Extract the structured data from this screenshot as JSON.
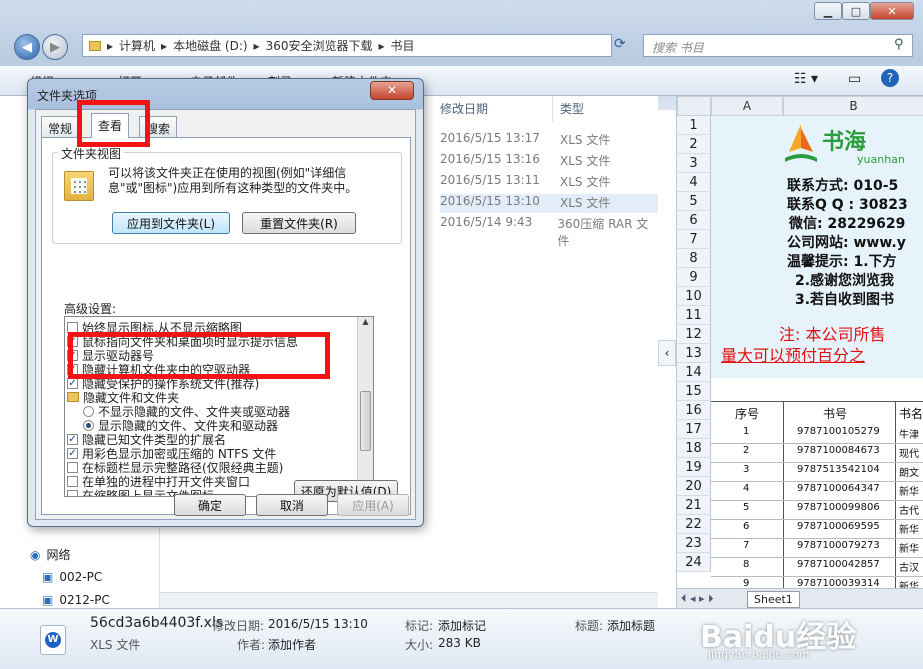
{
  "explorer": {
    "path": [
      "计算机",
      "本地磁盘 (D:)",
      "360安全浏览器下载",
      "书目"
    ],
    "search_placeholder": "搜索 书目",
    "toolbar": [
      "组织 ▼",
      "打开 ▼",
      "电子邮件",
      "刻录",
      "新建文件夹"
    ],
    "columns": {
      "date": "修改日期",
      "type": "类型"
    },
    "files": [
      {
        "date": "2016/5/15 13:17",
        "type": "XLS 文件"
      },
      {
        "date": "2016/5/15 13:16",
        "type": "XLS 文件"
      },
      {
        "date": "2016/5/15 13:11",
        "type": "XLS 文件"
      },
      {
        "date": "2016/5/15 13:10",
        "type": "XLS 文件"
      },
      {
        "date": "2016/5/14 9:43",
        "type": "360压缩 RAR 文件"
      }
    ],
    "nav": [
      "网络",
      "002-PC",
      "0212-PC"
    ]
  },
  "status": {
    "filename": "56cd3a6b4403f.xls",
    "file_type": "XLS 文件",
    "modified_label": "修改日期:",
    "modified": "2016/5/15 13:10",
    "author_label": "作者:",
    "author": "添加作者",
    "tag_label": "标记:",
    "tag": "添加标记",
    "size_label": "大小:",
    "size": "283 KB",
    "title_label": "标题:",
    "title": "添加标题"
  },
  "preview": {
    "cols": [
      "A",
      "B"
    ],
    "rows": [
      "1",
      "2",
      "3",
      "4",
      "5",
      "6",
      "7",
      "8",
      "9",
      "10",
      "11",
      "12",
      "13",
      "14",
      "15",
      "16",
      "17",
      "18",
      "19",
      "20",
      "21",
      "22",
      "23",
      "24"
    ],
    "logo_text": "书海",
    "logo_sub": "yuanhan",
    "contact": "联系方式: 010-5",
    "qq": "联系Q Q : 30823",
    "wechat": "微信: 28229629",
    "site": "公司网站: www.y",
    "tip1": "温馨提示: 1.下方",
    "tip2": "2.感谢您浏览我",
    "tip3": "3.若自收到图书",
    "note1": "注: 本公司所售",
    "note2": "量大可以预付百分之",
    "table_head": [
      "序号",
      "书号",
      "书名"
    ],
    "table": [
      [
        "1",
        "9787100105279",
        "牛津"
      ],
      [
        "2",
        "9787100084673",
        "现代"
      ],
      [
        "3",
        "9787513542104",
        "朗文"
      ],
      [
        "4",
        "9787100064347",
        "新华"
      ],
      [
        "5",
        "9787100099806",
        "古代"
      ],
      [
        "6",
        "9787100069595",
        "新华"
      ],
      [
        "7",
        "9787100079273",
        "新华"
      ],
      [
        "8",
        "9787100042857",
        "古汉"
      ],
      [
        "9",
        "9787100039314",
        "新华"
      ]
    ],
    "sheet_tab": "Sheet1"
  },
  "dialog": {
    "title": "文件夹选项",
    "tabs": [
      "常规",
      "查看",
      "搜索"
    ],
    "group_title": "文件夹视图",
    "group_text": "可以将该文件夹正在使用的视图(例如\"详细信息\"或\"图标\")应用到所有这种类型的文件夹中。",
    "apply_btn": "应用到文件夹(L)",
    "reset_btn": "重置文件夹(R)",
    "adv_label": "高级设置:",
    "items": [
      {
        "kind": "cb",
        "checked": false,
        "text": "始终显示图标,从不显示缩略图"
      },
      {
        "kind": "cb",
        "checked": true,
        "text": "鼠标指向文件夹和桌面项时显示提示信息"
      },
      {
        "kind": "cb",
        "checked": true,
        "text": "显示驱动器号"
      },
      {
        "kind": "cb",
        "checked": true,
        "text": "隐藏计算机文件夹中的空驱动器"
      },
      {
        "kind": "cb",
        "checked": true,
        "text": "隐藏受保护的操作系统文件(推荐)"
      },
      {
        "kind": "folder",
        "text": "隐藏文件和文件夹"
      },
      {
        "kind": "rb",
        "checked": false,
        "text": "不显示隐藏的文件、文件夹或驱动器"
      },
      {
        "kind": "rb",
        "checked": true,
        "text": "显示隐藏的文件、文件夹和驱动器"
      },
      {
        "kind": "cb",
        "checked": true,
        "text": "隐藏已知文件类型的扩展名"
      },
      {
        "kind": "cb",
        "checked": true,
        "text": "用彩色显示加密或压缩的 NTFS 文件"
      },
      {
        "kind": "cb",
        "checked": false,
        "text": "在标题栏显示完整路径(仅限经典主题)"
      },
      {
        "kind": "cb",
        "checked": false,
        "text": "在单独的进程中打开文件夹窗口"
      },
      {
        "kind": "cb",
        "checked": false,
        "text": "在缩略图上显示文件图标"
      }
    ],
    "restore_btn": "还原为默认值(D)",
    "ok": "确定",
    "cancel": "取消",
    "apply": "应用(A)"
  },
  "watermark": "Baidu经验",
  "watermark_sub": "jingyan.baidu.com"
}
